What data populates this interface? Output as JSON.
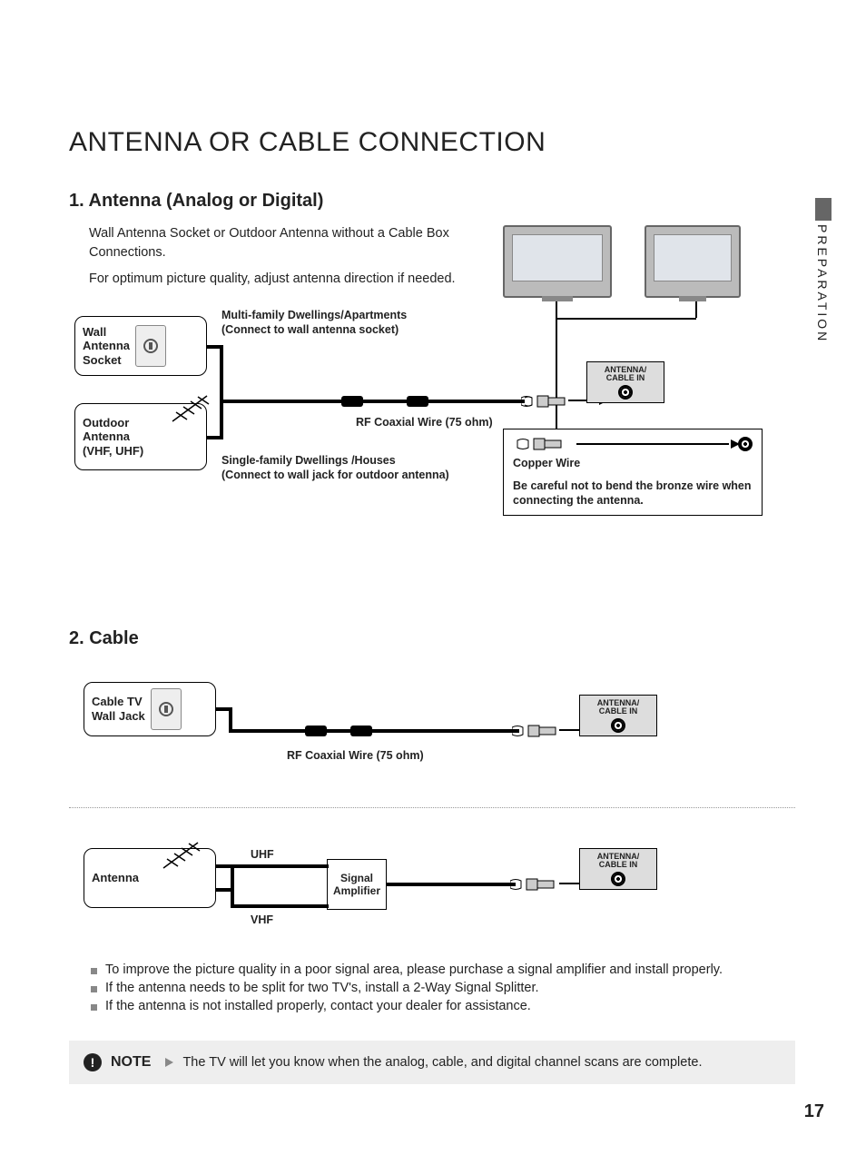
{
  "title": "ANTENNA OR CABLE CONNECTION",
  "sidetab": "PREPARATION",
  "pageNumber": "17",
  "section1": {
    "heading": "1. Antenna (Analog or Digital)",
    "intro1": "Wall Antenna Socket or Outdoor Antenna without a Cable Box Connections.",
    "intro2": "For optimum picture quality, adjust antenna direction if needed.",
    "wallSocketLabel": "Wall\nAntenna\nSocket",
    "outdoorLabel": "Outdoor\nAntenna\n(VHF, UHF)",
    "multiLabel": "Multi-family Dwellings/Apartments\n(Connect to wall antenna socket)",
    "singleLabel": "Single-family Dwellings /Houses\n(Connect to wall jack for outdoor antenna)",
    "rfLabel": "RF Coaxial Wire (75 ohm)",
    "portLabel": "ANTENNA/\nCABLE IN",
    "copperLabel": "Copper Wire",
    "warn": "Be careful not to bend the bronze wire when connecting the antenna."
  },
  "section2": {
    "heading": "2. Cable",
    "cableJackLabel": "Cable TV\nWall Jack",
    "rfLabel": "RF Coaxial Wire (75 ohm)",
    "portLabel": "ANTENNA/\nCABLE IN",
    "antennaLabel": "Antenna",
    "uhf": "UHF",
    "vhf": "VHF",
    "amplifier": "Signal\nAmplifier",
    "bullets": [
      "To improve the picture quality in a poor signal area, please purchase a signal amplifier and install properly.",
      "If the antenna needs to be split for two TV's, install a 2-Way Signal Splitter.",
      "If the antenna is not installed properly, contact your dealer for assistance."
    ]
  },
  "note": {
    "label": "NOTE",
    "text": "The TV will let you know when the analog, cable, and digital channel scans are complete."
  }
}
